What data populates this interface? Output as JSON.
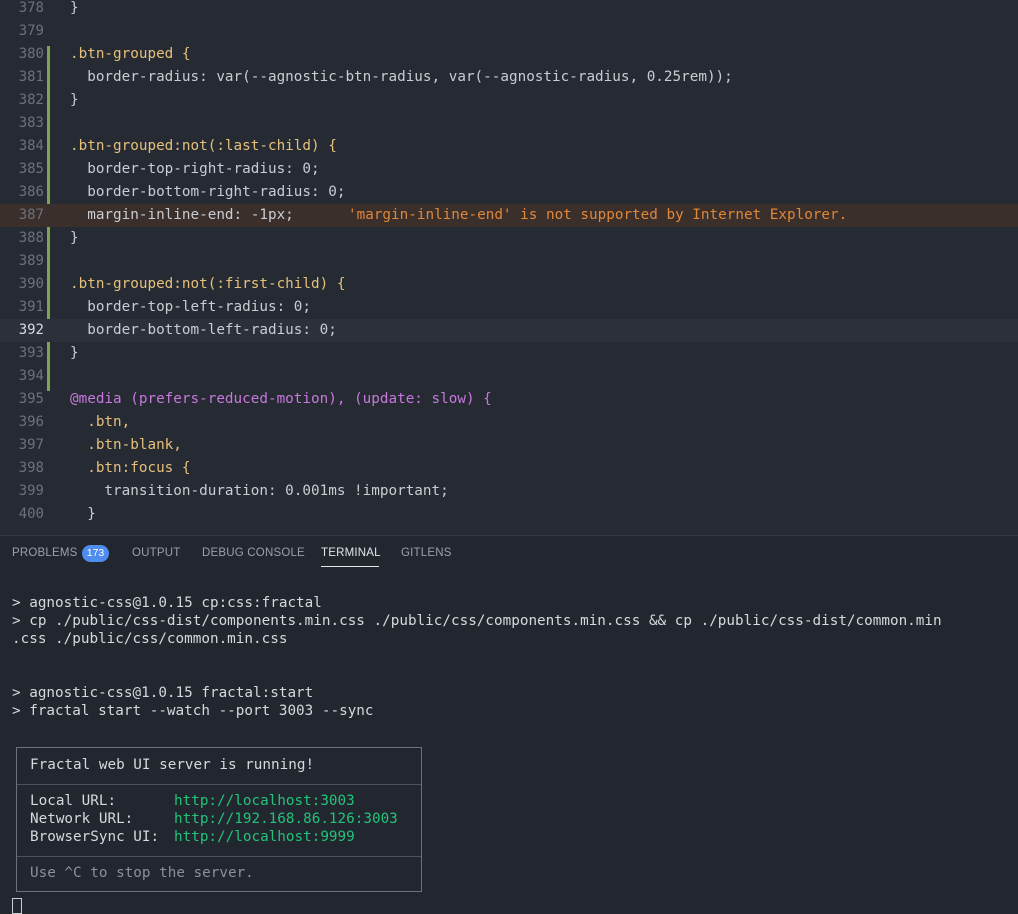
{
  "editor": {
    "current_line": "392",
    "lines": [
      {
        "n": "378",
        "code": "}"
      },
      {
        "n": "379",
        "code": ""
      },
      {
        "n": "380",
        "code": ".btn-grouped {"
      },
      {
        "n": "381",
        "code": "  border-radius: var(--agnostic-btn-radius, var(--agnostic-radius, 0.25rem));"
      },
      {
        "n": "382",
        "code": "}"
      },
      {
        "n": "383",
        "code": ""
      },
      {
        "n": "384",
        "code": ".btn-grouped:not(:last-child) {"
      },
      {
        "n": "385",
        "code": "  border-top-right-radius: 0;"
      },
      {
        "n": "386",
        "code": "  border-bottom-right-radius: 0;"
      },
      {
        "n": "387",
        "code": "  margin-inline-end: -1px;"
      },
      {
        "n": "388",
        "code": "}"
      },
      {
        "n": "389",
        "code": ""
      },
      {
        "n": "390",
        "code": ".btn-grouped:not(:first-child) {"
      },
      {
        "n": "391",
        "code": "  border-top-left-radius: 0;"
      },
      {
        "n": "392",
        "code": "  border-bottom-left-radius: 0;"
      },
      {
        "n": "393",
        "code": "}"
      },
      {
        "n": "394",
        "code": ""
      },
      {
        "n": "395",
        "code": "@media (prefers-reduced-motion), (update: slow) {"
      },
      {
        "n": "396",
        "code": "  .btn,"
      },
      {
        "n": "397",
        "code": "  .btn-blank,"
      },
      {
        "n": "398",
        "code": "  .btn:focus {"
      },
      {
        "n": "399",
        "code": "    transition-duration: 0.001ms !important;"
      },
      {
        "n": "400",
        "code": "  }"
      }
    ],
    "warning_message": "'margin-inline-end' is not supported by Internet Explorer."
  },
  "panel": {
    "tabs": [
      {
        "label": "PROBLEMS",
        "active": false
      },
      {
        "label": "OUTPUT",
        "active": false
      },
      {
        "label": "DEBUG CONSOLE",
        "active": false
      },
      {
        "label": "TERMINAL",
        "active": true
      },
      {
        "label": "GITLENS",
        "active": false
      }
    ],
    "problems_count": "173"
  },
  "terminal": {
    "lines": [
      "> agnostic-css@1.0.15 cp:css:fractal",
      "> cp ./public/css-dist/components.min.css ./public/css/components.min.css && cp ./public/css-dist/common.min",
      ".css ./public/css/common.min.css",
      "> agnostic-css@1.0.15 fractal:start",
      "> fractal start --watch --port 3003 --sync"
    ],
    "box": {
      "title": "Fractal web UI server is running!",
      "rows": [
        {
          "label": "Local URL:      ",
          "value": "http://localhost:3003"
        },
        {
          "label": "Network URL:    ",
          "value": "http://192.168.86.126:3003"
        },
        {
          "label": "BrowserSync UI: ",
          "value": "http://localhost:9999"
        }
      ],
      "footer": "Use ^C to stop the server."
    }
  },
  "colors": {
    "accent": "#4f8cf0",
    "url": "#23c37a",
    "warning": "#e0873a",
    "git_added": "#7ea353"
  },
  "icons": [
    "terminal-arrow-icon",
    "cursor-block"
  ]
}
